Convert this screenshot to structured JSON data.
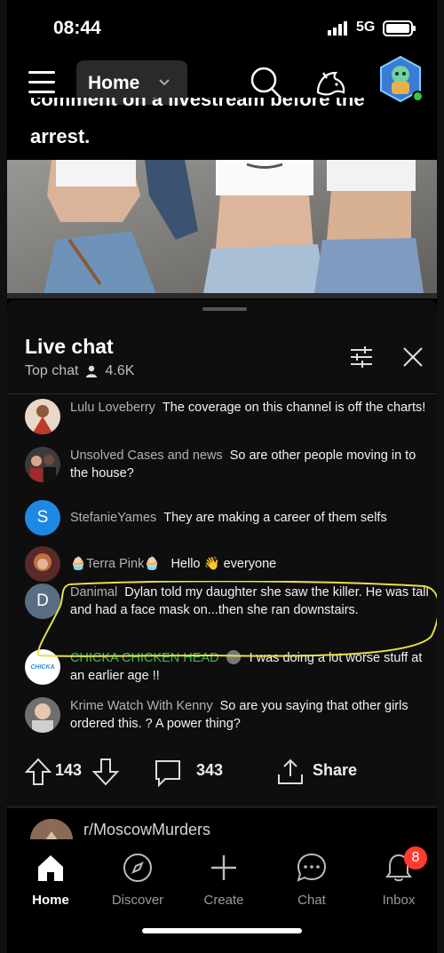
{
  "status_bar": {
    "time": "08:44",
    "network": "5G"
  },
  "header": {
    "feed_selector": "Home"
  },
  "post": {
    "title_fragment_top": "comment on a livestream before the",
    "title_fragment": "arrest."
  },
  "live_chat": {
    "title": "Live chat",
    "mode": "Top chat",
    "viewers": "4.6K",
    "messages": [
      {
        "author": "Lulu Loveberry",
        "text": "The coverage on this channel is off the charts!",
        "avatar": "photo"
      },
      {
        "author": "Unsolved Cases and news",
        "text": "So are other people moving in to the house?",
        "avatar": "photo"
      },
      {
        "author": "StefanieYames",
        "text": "They are making a career of them selfs",
        "avatar_letter": "S",
        "avatar_color": "#1e88e5"
      },
      {
        "author": "Terra Pink",
        "text": "Hello 👋 everyone",
        "avatar": "photo"
      },
      {
        "author": "Danimal",
        "text": "Dylan told my daughter she saw the killer. He was tall and had a face mask on...then she ran downstairs.",
        "avatar_letter": "D",
        "avatar_color": "#5a6d82"
      },
      {
        "author": "CHICKA CHICKEN HEAD",
        "text": "I was doing a lot worse stuff at an earlier age !!",
        "avatar": "logo",
        "author_color": "#3dbb4f",
        "avatar_logo_text": "CHICKA"
      },
      {
        "author": "Krime Watch With Kenny",
        "text": "So are you saying that other girls ordered this. ? A power thing?",
        "avatar": "photo"
      }
    ]
  },
  "actions": {
    "upvotes": "143",
    "comments": "343",
    "share": "Share"
  },
  "next_post": {
    "subreddit": "r/MoscowMurders"
  },
  "bottom_nav": {
    "items": [
      {
        "label": "Home",
        "icon": "home-icon"
      },
      {
        "label": "Discover",
        "icon": "compass-icon"
      },
      {
        "label": "Create",
        "icon": "plus-icon"
      },
      {
        "label": "Chat",
        "icon": "chat-icon"
      },
      {
        "label": "Inbox",
        "icon": "bell-icon"
      }
    ],
    "inbox_badge": "8"
  },
  "colors": {
    "accent_green": "#3dbb4f",
    "badge_red": "#ff3b30",
    "highlight_ring": "#e6e04a"
  }
}
